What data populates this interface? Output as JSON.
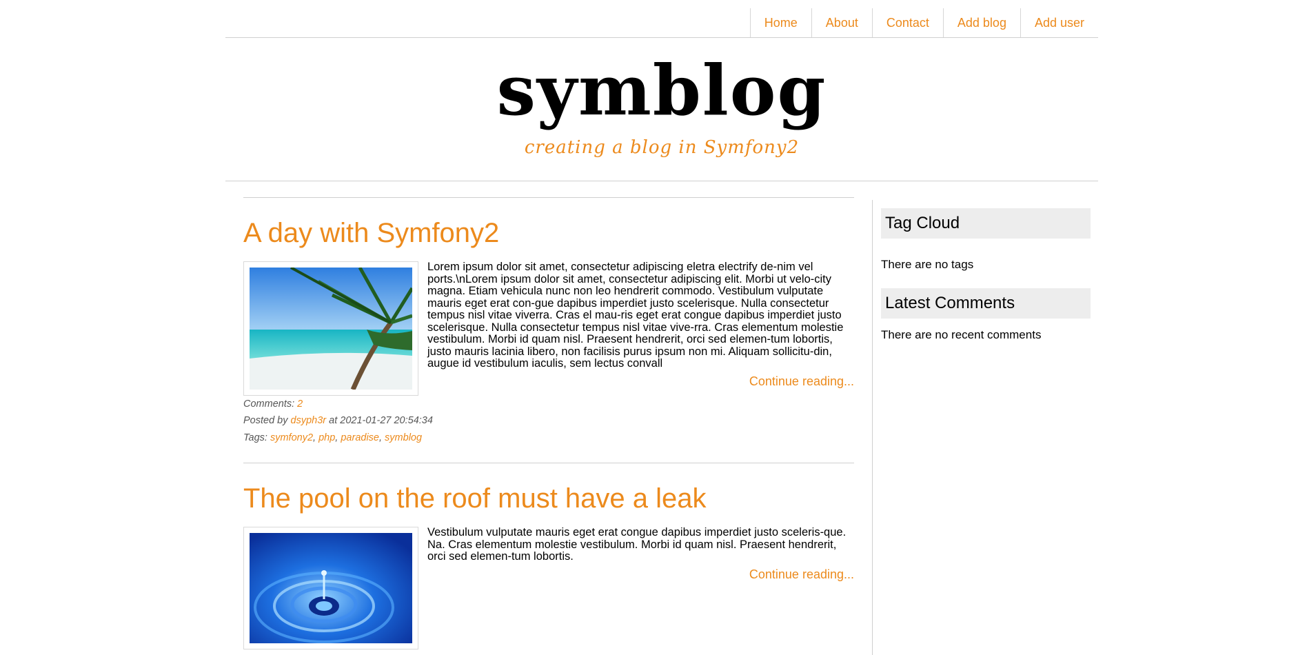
{
  "nav": {
    "items": [
      {
        "label": "Home"
      },
      {
        "label": "About"
      },
      {
        "label": "Contact"
      },
      {
        "label": "Add blog"
      },
      {
        "label": "Add user"
      }
    ]
  },
  "header": {
    "title": "symblog",
    "subtitle": "creating a blog in Symfony2"
  },
  "articles": [
    {
      "title": "A day with Symfony2",
      "image_alt": "beach",
      "text": "Lorem ipsum dolor sit amet, consectetur adipiscing eletra electrify de-nim vel ports.\\nLorem ipsum dolor sit amet, consectetur adipiscing elit. Morbi ut velo-city magna. Etiam vehicula nunc non leo hendrerit commodo. Vestibulum vulputate mauris eget erat con-gue dapibus imperdiet justo scelerisque. Nulla consectetur tempus nisl vitae viverra. Cras el mau-ris eget erat congue dapibus imperdiet justo scelerisque. Nulla consectetur tempus nisl vitae vive-rra. Cras elementum molestie vestibulum. Morbi id quam nisl. Praesent hendrerit, orci sed elemen-tum lobortis, justo mauris lacinia libero, non facilisis purus ipsum non mi. Aliquam sollicitu-din, augue id vestibulum iaculis, sem lectus convall",
      "more": "Continue reading...",
      "comments_label": "Comments:",
      "comments_count": "2",
      "posted_by_label": "Posted by",
      "author": "dsyph3r",
      "at_label": "at 2021-01-27 20:54:34",
      "tags_label": "Tags:",
      "tags": [
        "symfony2",
        "php",
        "paradise",
        "symblog"
      ]
    },
    {
      "title": "The pool on the roof must have a leak",
      "image_alt": "water drop",
      "text": "Vestibulum vulputate mauris eget erat congue dapibus imperdiet justo sceleris-que. Na. Cras elementum molestie vestibulum. Morbi id quam nisl. Praesent hendrerit, orci sed elemen-tum lobortis.",
      "more": "Continue reading..."
    }
  ],
  "sidebar": {
    "tag_cloud_title": "Tag Cloud",
    "tag_cloud_empty": "There are no tags",
    "comments_title": "Latest Comments",
    "comments_empty": "There are no recent comments"
  },
  "colors": {
    "accent": "#ec8a1c",
    "border": "#cfcfcf",
    "sidebar_header_bg": "#ededed"
  }
}
